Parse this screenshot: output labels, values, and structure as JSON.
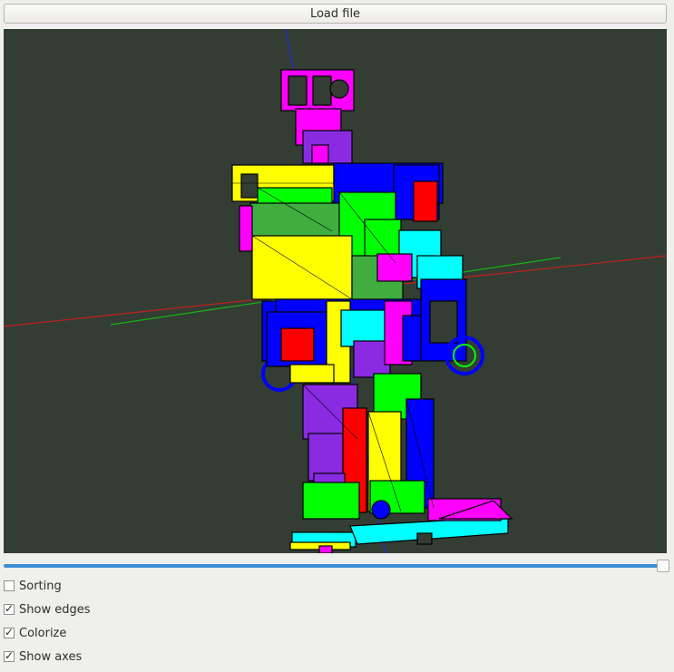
{
  "toolbar": {
    "load_label": "Load file"
  },
  "viewport": {
    "background": "#333d33",
    "axis_colors": {
      "x": "#c0201f",
      "y": "#19b31b",
      "z": "#1d2ad6"
    },
    "part_colors": [
      "#ff00ff",
      "#ffff00",
      "#00ff00",
      "#0000ff",
      "#ff0000",
      "#00ffff",
      "#8a2be2"
    ],
    "model": "humanoid-robot"
  },
  "slider": {
    "value": 1.0
  },
  "options": [
    {
      "label": "Sorting",
      "checked": false,
      "mark": ""
    },
    {
      "label": "Show edges",
      "checked": true,
      "mark": "✓"
    },
    {
      "label": "Colorize",
      "checked": true,
      "mark": "✓"
    },
    {
      "label": "Show axes",
      "checked": true,
      "mark": "✓"
    }
  ]
}
